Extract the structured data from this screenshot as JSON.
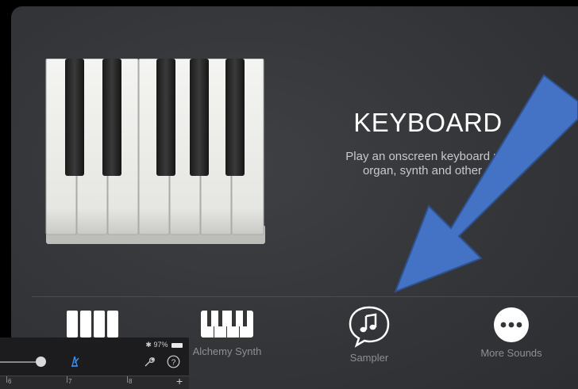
{
  "panel": {
    "title": "KEYBOARD",
    "description": "Play an onscreen keyboard usin\norgan, synth and other so"
  },
  "sounds": [
    {
      "label": "Alchemy Synth",
      "icon": "synth-keys-icon"
    },
    {
      "label": "Sampler",
      "icon": "sampler-note-icon"
    },
    {
      "label": "More Sounds",
      "icon": "more-dots-icon"
    }
  ],
  "mini_app": {
    "battery": "97%",
    "ruler_marks": [
      "6",
      "7",
      "8"
    ]
  },
  "colors": {
    "arrow": "#4472c4",
    "card": "#333538"
  }
}
